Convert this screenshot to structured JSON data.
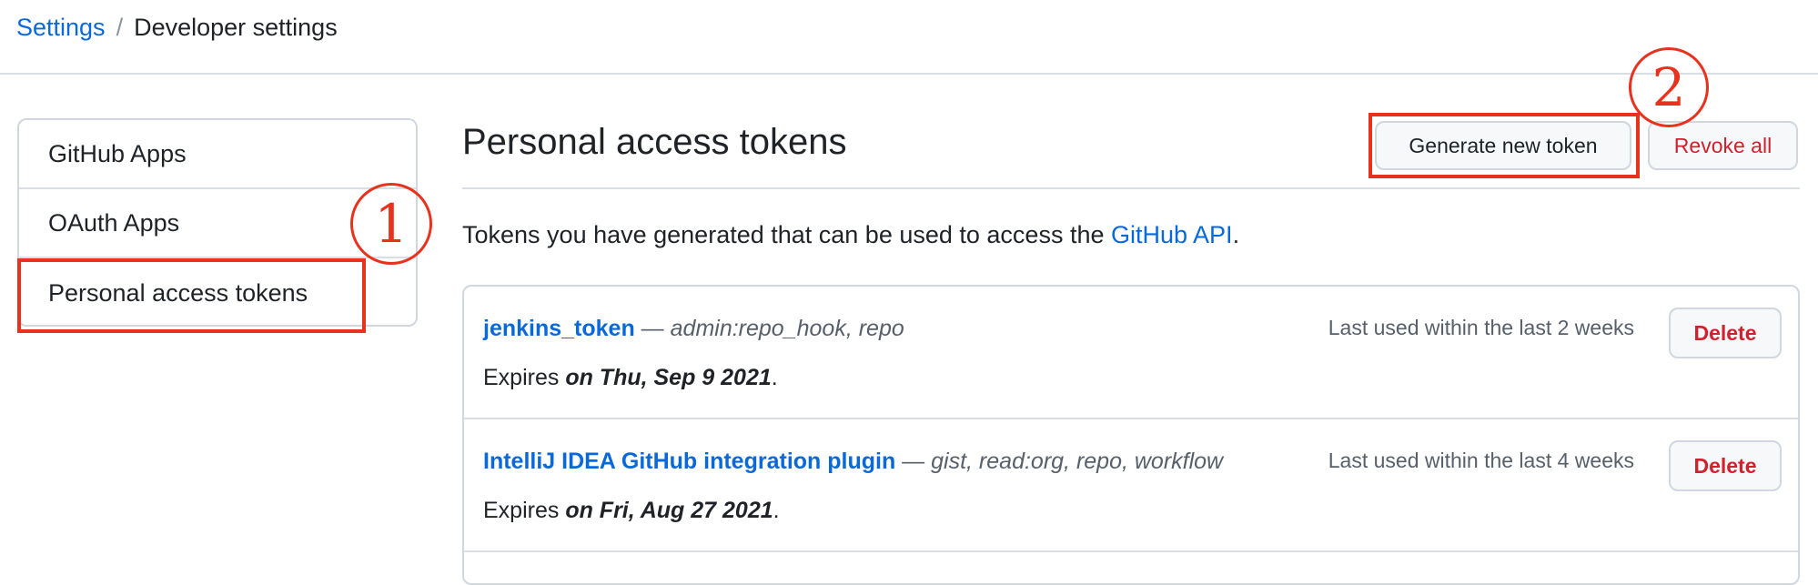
{
  "breadcrumb": {
    "root": "Settings",
    "separator": "/",
    "current": "Developer settings"
  },
  "sidebar": {
    "items": [
      {
        "label": "GitHub Apps"
      },
      {
        "label": "OAuth Apps"
      },
      {
        "label": "Personal access tokens",
        "selected": true
      }
    ]
  },
  "header": {
    "title": "Personal access tokens",
    "generate_label": "Generate new token",
    "revoke_label": "Revoke all"
  },
  "description": {
    "text": "Tokens you have generated that can be used to access the ",
    "link": "GitHub API",
    "suffix": "."
  },
  "tokens": [
    {
      "name": "jenkins_token",
      "dash": " — ",
      "scopes": "admin:repo_hook, repo",
      "last_used": "Last used within the last 2 weeks",
      "expires_prefix": "Expires ",
      "expires_date": "on Thu, Sep 9 2021",
      "expires_suffix": ".",
      "delete_label": "Delete"
    },
    {
      "name": "IntelliJ IDEA GitHub integration plugin",
      "dash": " — ",
      "scopes": "gist, read:org, repo, workflow",
      "last_used": "Last used within the last 4 weeks",
      "expires_prefix": "Expires ",
      "expires_date": "on Fri, Aug 27 2021",
      "expires_suffix": ".",
      "delete_label": "Delete"
    }
  ],
  "annotations": {
    "step1": "1",
    "step2": "2",
    "color": "#e8321e"
  },
  "colors": {
    "link": "#0969da",
    "danger": "#cf222e",
    "border": "#d0d7de",
    "text": "#1f2328",
    "muted": "#57606a"
  }
}
